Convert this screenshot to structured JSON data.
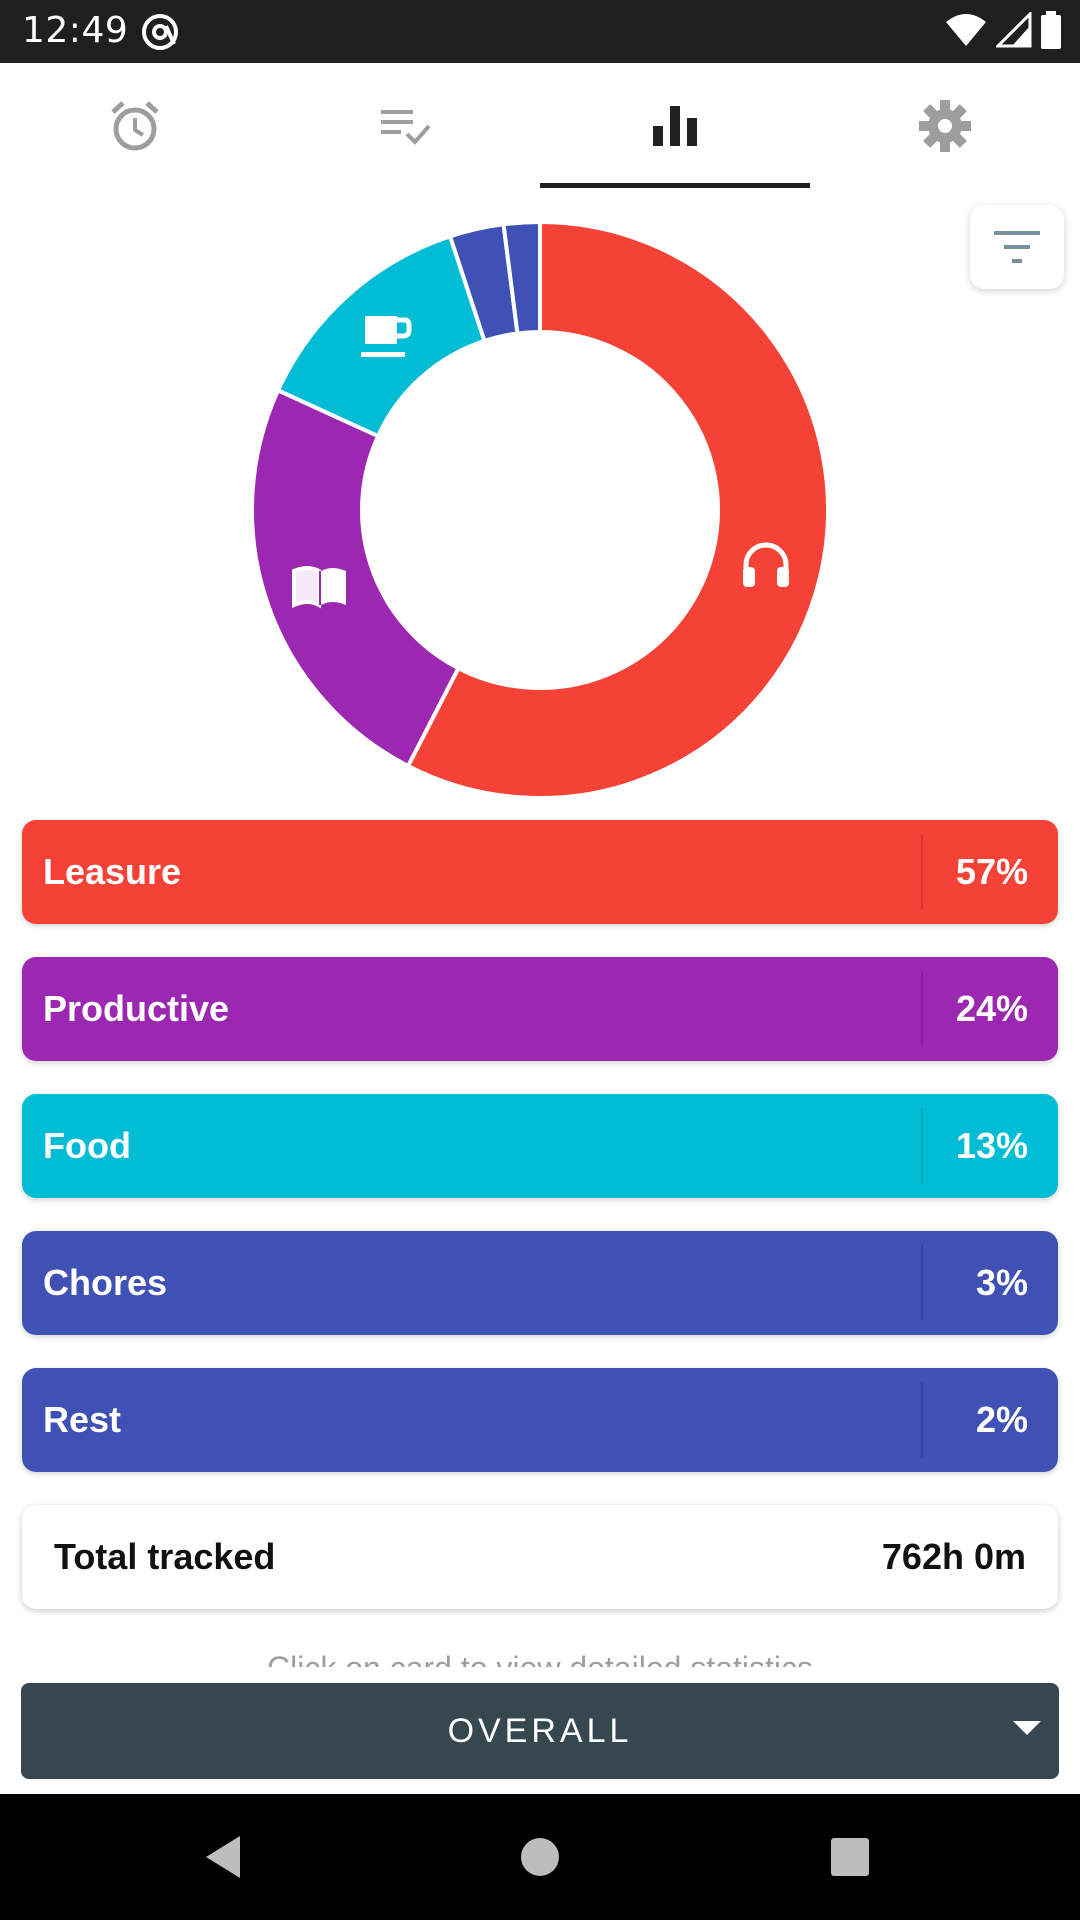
{
  "status_bar": {
    "time": "12:49",
    "icons": [
      "at-notification-icon",
      "wifi-icon",
      "cellular-signal-icon",
      "battery-icon"
    ]
  },
  "tabs": [
    {
      "name": "tab-timer",
      "icon": "alarm-clock-icon",
      "active": false
    },
    {
      "name": "tab-records",
      "icon": "playlist-check-icon",
      "active": false
    },
    {
      "name": "tab-statistics",
      "icon": "bar-chart-icon",
      "active": true
    },
    {
      "name": "tab-settings",
      "icon": "gear-icon",
      "active": false
    }
  ],
  "filter_button": {
    "icon": "filter-icon"
  },
  "chart_data": {
    "type": "pie",
    "style": "donut",
    "title": "",
    "categories": [
      "Leasure",
      "Productive",
      "Food",
      "Chores",
      "Rest"
    ],
    "values": [
      57,
      24,
      13,
      3,
      2
    ],
    "unit": "%",
    "colors": [
      "#f44336",
      "#9c27b0",
      "#00bcd4",
      "#3f51b5",
      "#3f51b5"
    ],
    "icons": [
      "headphones-icon",
      "book-icon",
      "coffee-cup-icon",
      "",
      ""
    ]
  },
  "categories": [
    {
      "label": "Leasure",
      "percent": "57%",
      "color": "#f44336"
    },
    {
      "label": "Productive",
      "percent": "24%",
      "color": "#9c27b0"
    },
    {
      "label": "Food",
      "percent": "13%",
      "color": "#00bcd4"
    },
    {
      "label": "Chores",
      "percent": "3%",
      "color": "#3f51b5"
    },
    {
      "label": "Rest",
      "percent": "2%",
      "color": "#3f51b5"
    }
  ],
  "total": {
    "label": "Total tracked",
    "value": "762h 0m"
  },
  "hint": "Click on card to view detailed statistics",
  "range_selector": {
    "selected": "OVERALL",
    "icon": "dropdown-arrow-icon"
  },
  "nav_bar": {
    "icons": [
      "back-icon",
      "home-icon",
      "recents-icon"
    ]
  }
}
